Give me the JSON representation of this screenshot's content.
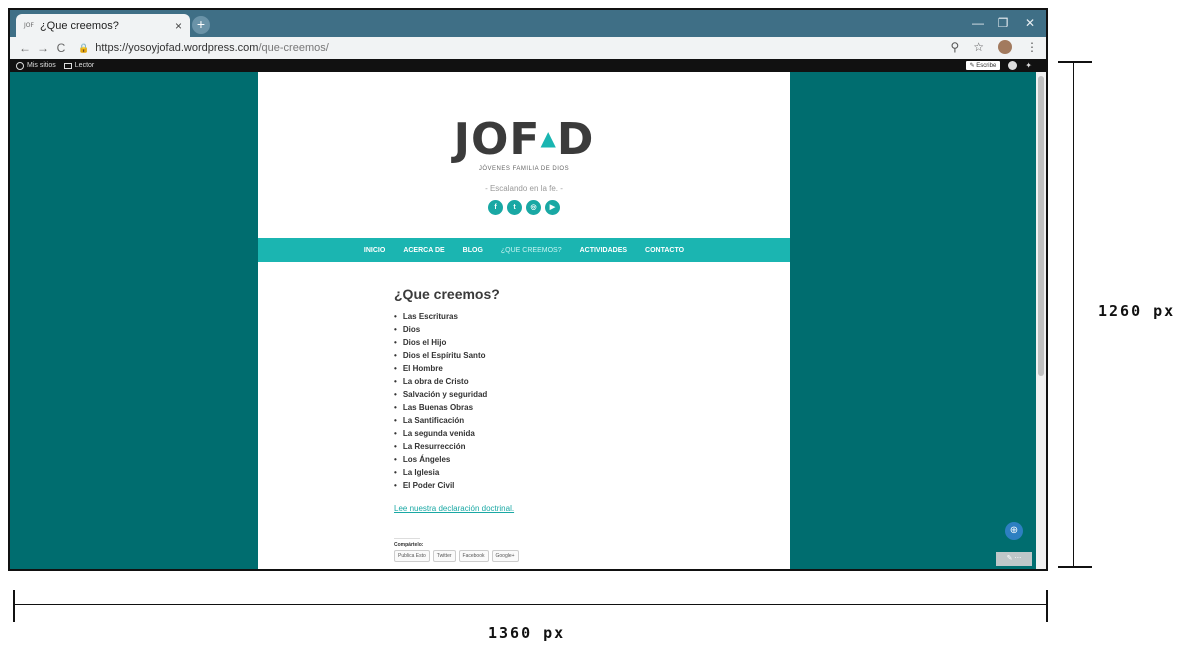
{
  "browser": {
    "tab_title": "¿Que creemos?",
    "tab_close": "×",
    "new_tab": "+",
    "url_domain": "https://yosoyjofad.wordpress.com",
    "url_path": "/que-creemos/"
  },
  "wpbar": {
    "my_sites": "Mis sitios",
    "reader": "Lector",
    "write": "Escribe"
  },
  "site": {
    "logo": "JOF",
    "logo_end": "D",
    "logo_subtitle": "JÓVENES FAMILIA DE DIOS",
    "tagline": "- Escalando en la fe. -",
    "social_icons": [
      "facebook-icon",
      "twitter-icon",
      "instagram-icon",
      "youtube-icon"
    ],
    "menu": [
      "INICIO",
      "ACERCA DE",
      "BLOG",
      "¿QUE CREEMOS?",
      "ACTIVIDADES",
      "CONTACTO"
    ]
  },
  "content": {
    "title": "¿Que creemos?",
    "beliefs": [
      "Las Escrituras",
      "Dios",
      "Dios el Hijo",
      "Dios el Espíritu Santo",
      "El Hombre",
      "La obra de Cristo",
      "Salvación y seguridad",
      "Las Buenas Obras",
      "La Santificación",
      "La segunda venida",
      "La Resurrección",
      "Los Ángeles",
      "La Iglesia",
      "El Poder Civil"
    ],
    "doctrine_link": "Lee nuestra declaración doctrinal.",
    "share_label": "Compártelo:",
    "share_buttons": [
      "Publica Esto",
      "Twitter",
      "Facebook",
      "Google+"
    ]
  },
  "annotations": {
    "height_label": "1260 px",
    "width_label": "1360 px"
  },
  "colors": {
    "background": "#006d6f",
    "accent": "#1bb5b1"
  }
}
